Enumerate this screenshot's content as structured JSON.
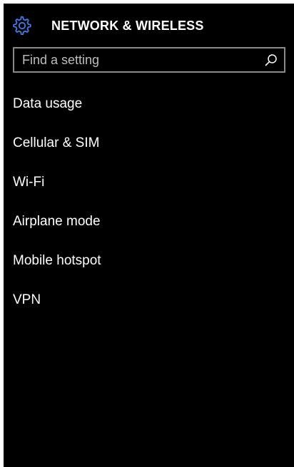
{
  "header": {
    "title": "NETWORK & WIRELESS",
    "icon": "gear-icon",
    "accent_color": "#3f7ce8"
  },
  "search": {
    "placeholder": "Find a setting",
    "value": "",
    "icon": "search-icon"
  },
  "menu": {
    "items": [
      {
        "label": "Data usage"
      },
      {
        "label": "Cellular & SIM"
      },
      {
        "label": "Wi-Fi"
      },
      {
        "label": "Airplane mode"
      },
      {
        "label": "Mobile hotspot"
      },
      {
        "label": "VPN"
      }
    ]
  }
}
